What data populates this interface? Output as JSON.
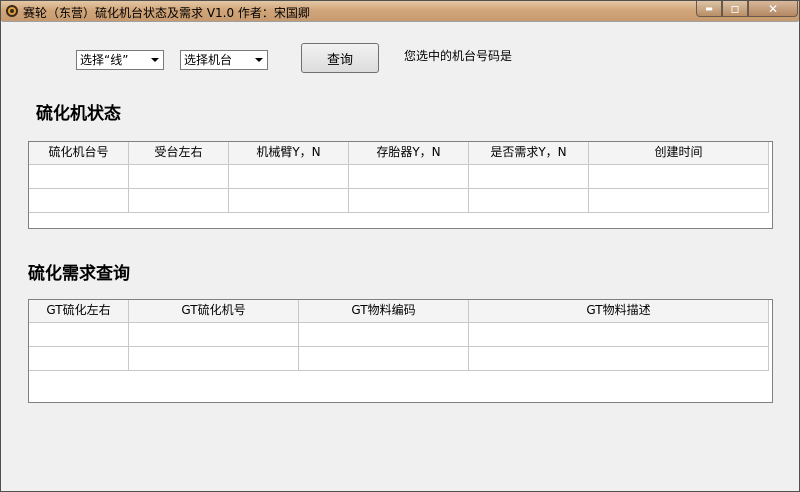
{
  "window": {
    "title": "赛轮（东营）硫化机台状态及需求 V1.0  作者：宋国卿",
    "minimize_glyph": "▬",
    "maximize_glyph": "▫",
    "close_glyph": "✕"
  },
  "toolbar": {
    "line_select": "选择“线”",
    "machine_select": "选择机台",
    "query_label": "查询",
    "selected_text": "您选中的机台号码是"
  },
  "status_section": {
    "title": "硫化机状态",
    "columns": [
      "硫化机台号",
      "受台左右",
      "机械臂Y，N",
      "存胎器Y，N",
      "是否需求Y，N",
      "创建时间"
    ]
  },
  "demand_section": {
    "title": "硫化需求查询",
    "columns": [
      "GT硫化左右",
      "GT硫化机号",
      "GT物料编码",
      "GT物料描述"
    ]
  }
}
